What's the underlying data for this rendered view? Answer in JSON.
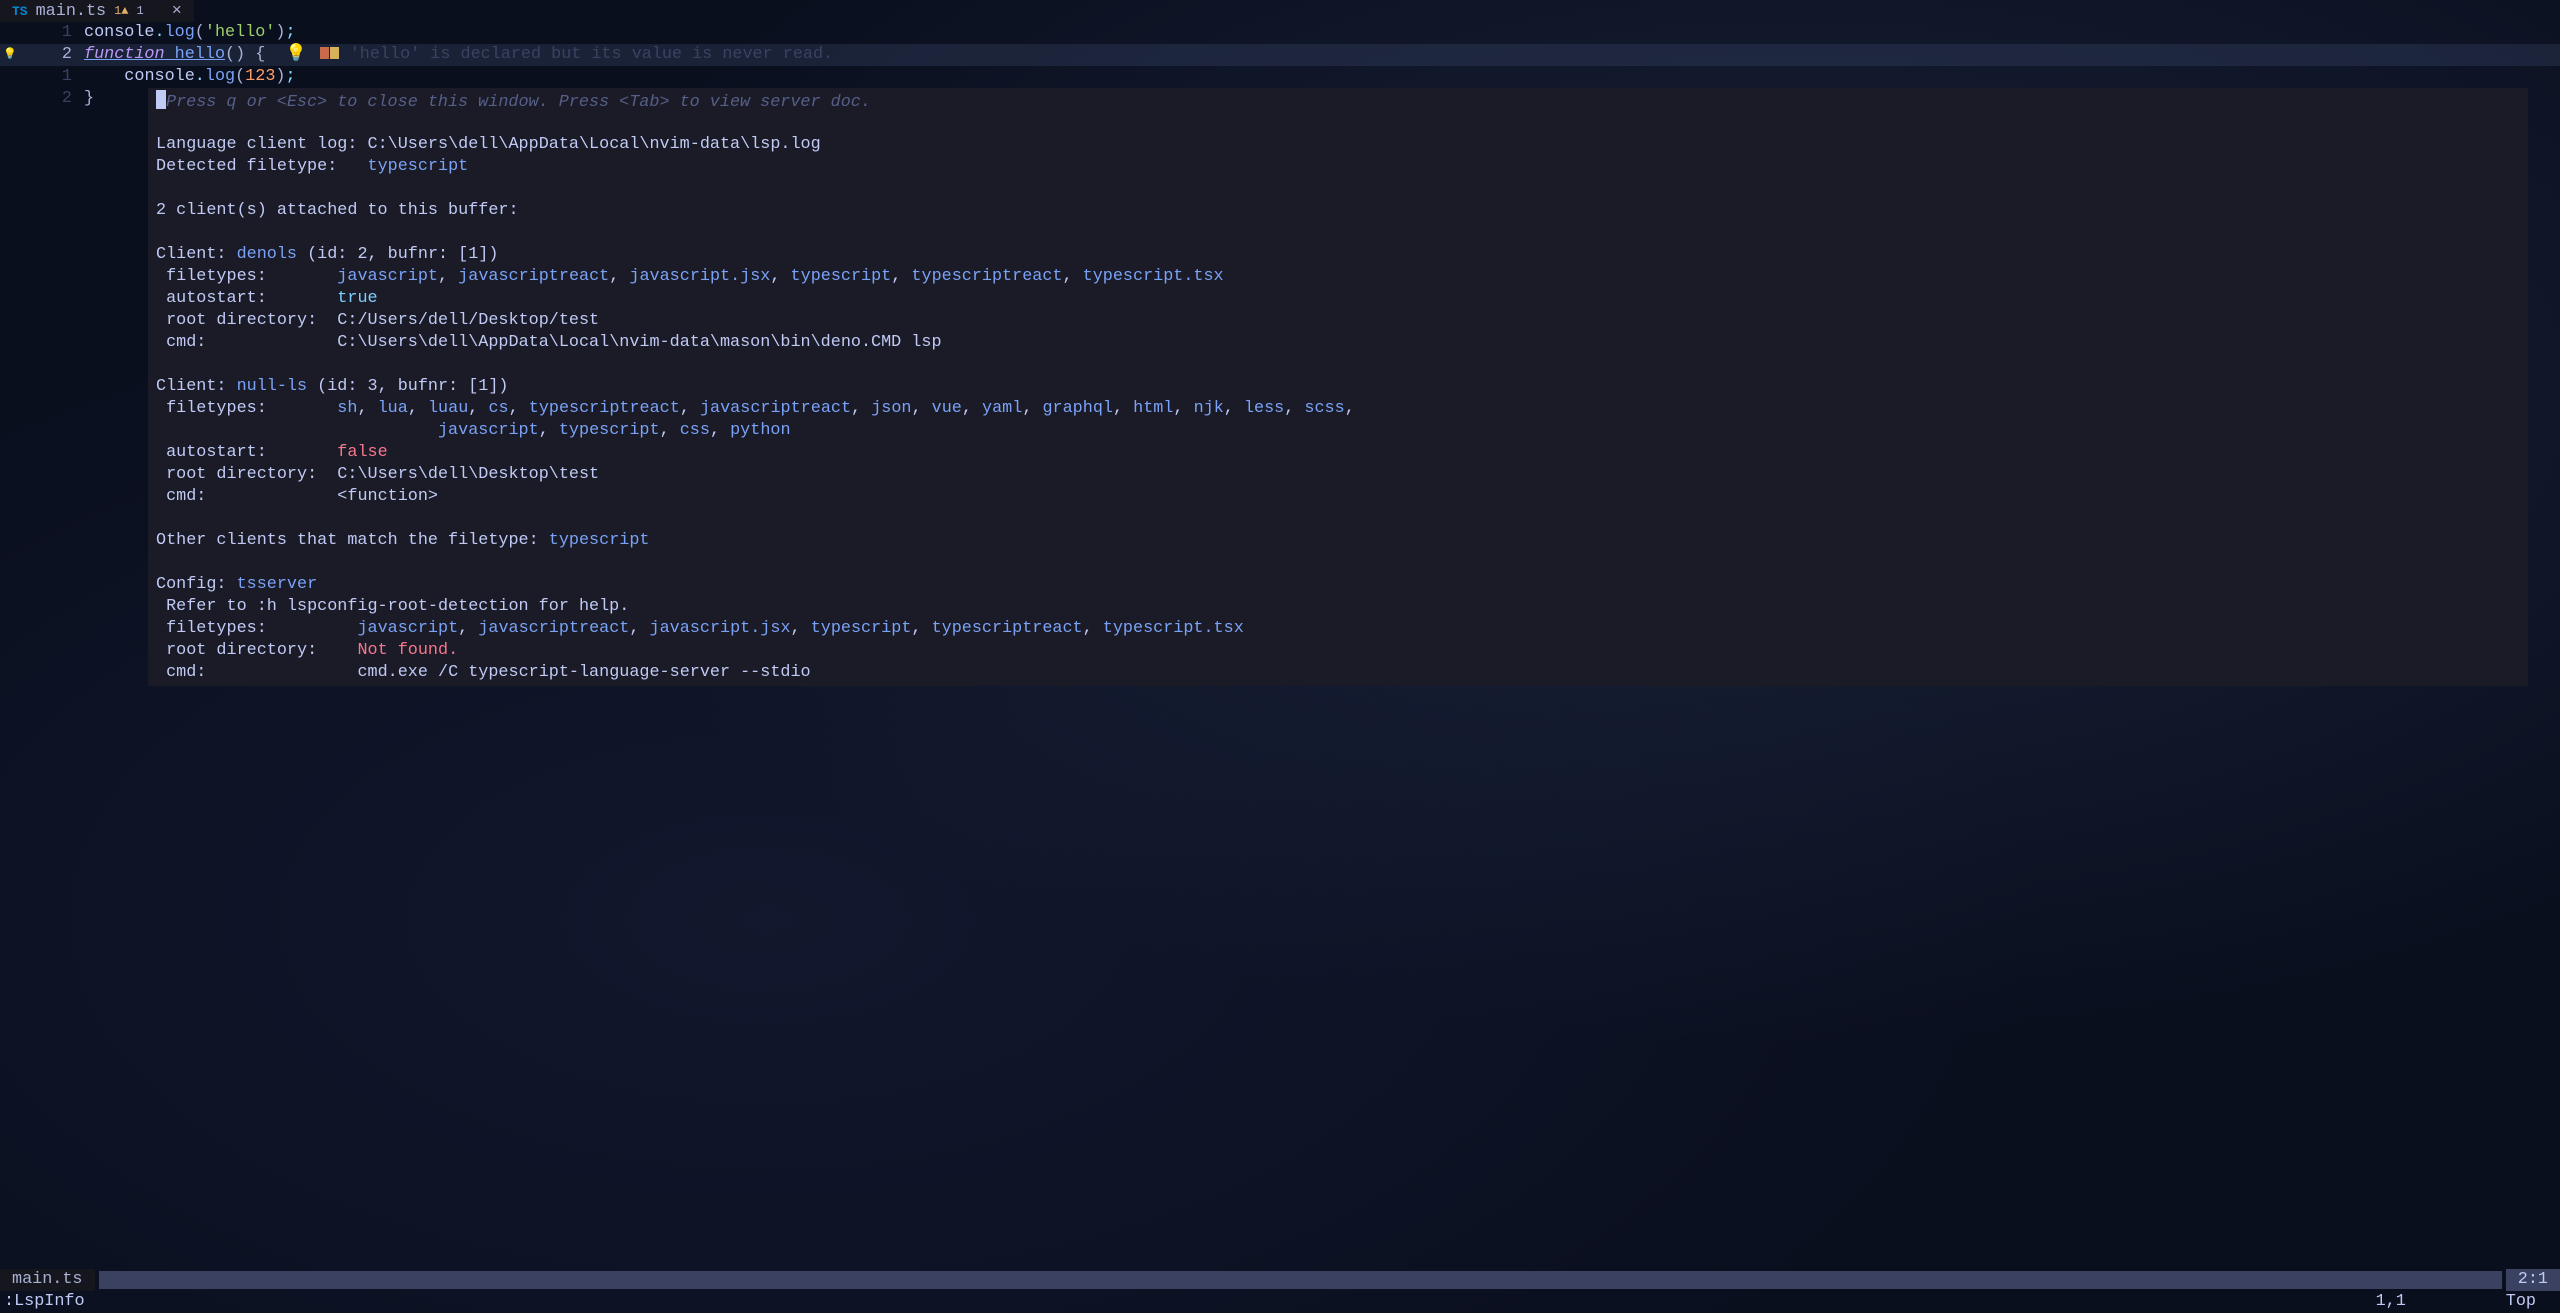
{
  "tab": {
    "icon": "TS",
    "filename": "main.ts",
    "diag1": "1▲",
    "diag2": "1",
    "close": "×"
  },
  "code": {
    "line1": {
      "num": "1"
    },
    "line2": {
      "num": "2"
    },
    "line3": {
      "num": "1"
    },
    "line4": {
      "num": "2"
    },
    "console": "console",
    "log": "log",
    "hello_str": "'hello'",
    "function": "function",
    "hello_fn": "hello",
    "num123": "123",
    "diag_text": "'hello' is declared but its value is never read."
  },
  "float": {
    "hint": "Press q or <Esc> to close this window. Press <Tab> to view server doc.",
    "log_label": "Language client log:",
    "log_path": "C:\\Users\\dell\\AppData\\Local\\nvim-data\\lsp.log",
    "detected_label": "Detected filetype:",
    "detected_type": "typescript",
    "clients_attached": "2 client(s) attached to this buffer:",
    "client1_label": "Client:",
    "client1_name": "denols",
    "client1_id": "(id: 2, bufnr: [1])",
    "filetypes_label": "filetypes:",
    "client1_ft": [
      "javascript",
      "javascriptreact",
      "javascript.jsx",
      "typescript",
      "typescriptreact",
      "typescript.tsx"
    ],
    "autostart_label": "autostart:",
    "client1_autostart": "true",
    "rootdir_label": "root directory:",
    "client1_rootdir": "C:/Users/dell/Desktop/test",
    "cmd_label": "cmd:",
    "client1_cmd": "C:\\Users\\dell\\AppData\\Local\\nvim-data\\mason\\bin\\deno.CMD lsp",
    "client2_name": "null-ls",
    "client2_id": "(id: 3, bufnr: [1])",
    "client2_ft_l1": [
      "sh",
      "lua",
      "luau",
      "cs",
      "typescriptreact",
      "javascriptreact",
      "json",
      "vue",
      "yaml",
      "graphql",
      "html",
      "njk",
      "less",
      "scss"
    ],
    "client2_ft_l2": [
      "javascript",
      "typescript",
      "css",
      "python"
    ],
    "client2_autostart": "false",
    "client2_rootdir": "C:\\Users\\dell\\Desktop\\test",
    "client2_cmd": "<function>",
    "other_clients_label": "Other clients that match the filetype:",
    "other_filetype": "typescript",
    "config_label": "Config:",
    "config_name": "tsserver",
    "refer_help": "Refer to :h lspconfig-root-detection for help.",
    "config_ft": [
      "javascript",
      "javascriptreact",
      "javascript.jsx",
      "typescript",
      "typescriptreact",
      "typescript.tsx"
    ],
    "config_rootdir": "Not found.",
    "config_cmd": "cmd.exe /C typescript-language-server --stdio"
  },
  "status": {
    "filename": "main.ts",
    "rc": "2:1"
  },
  "cmd": {
    "text": ":LspInfo",
    "pos": "1,1",
    "scroll": "Top"
  }
}
